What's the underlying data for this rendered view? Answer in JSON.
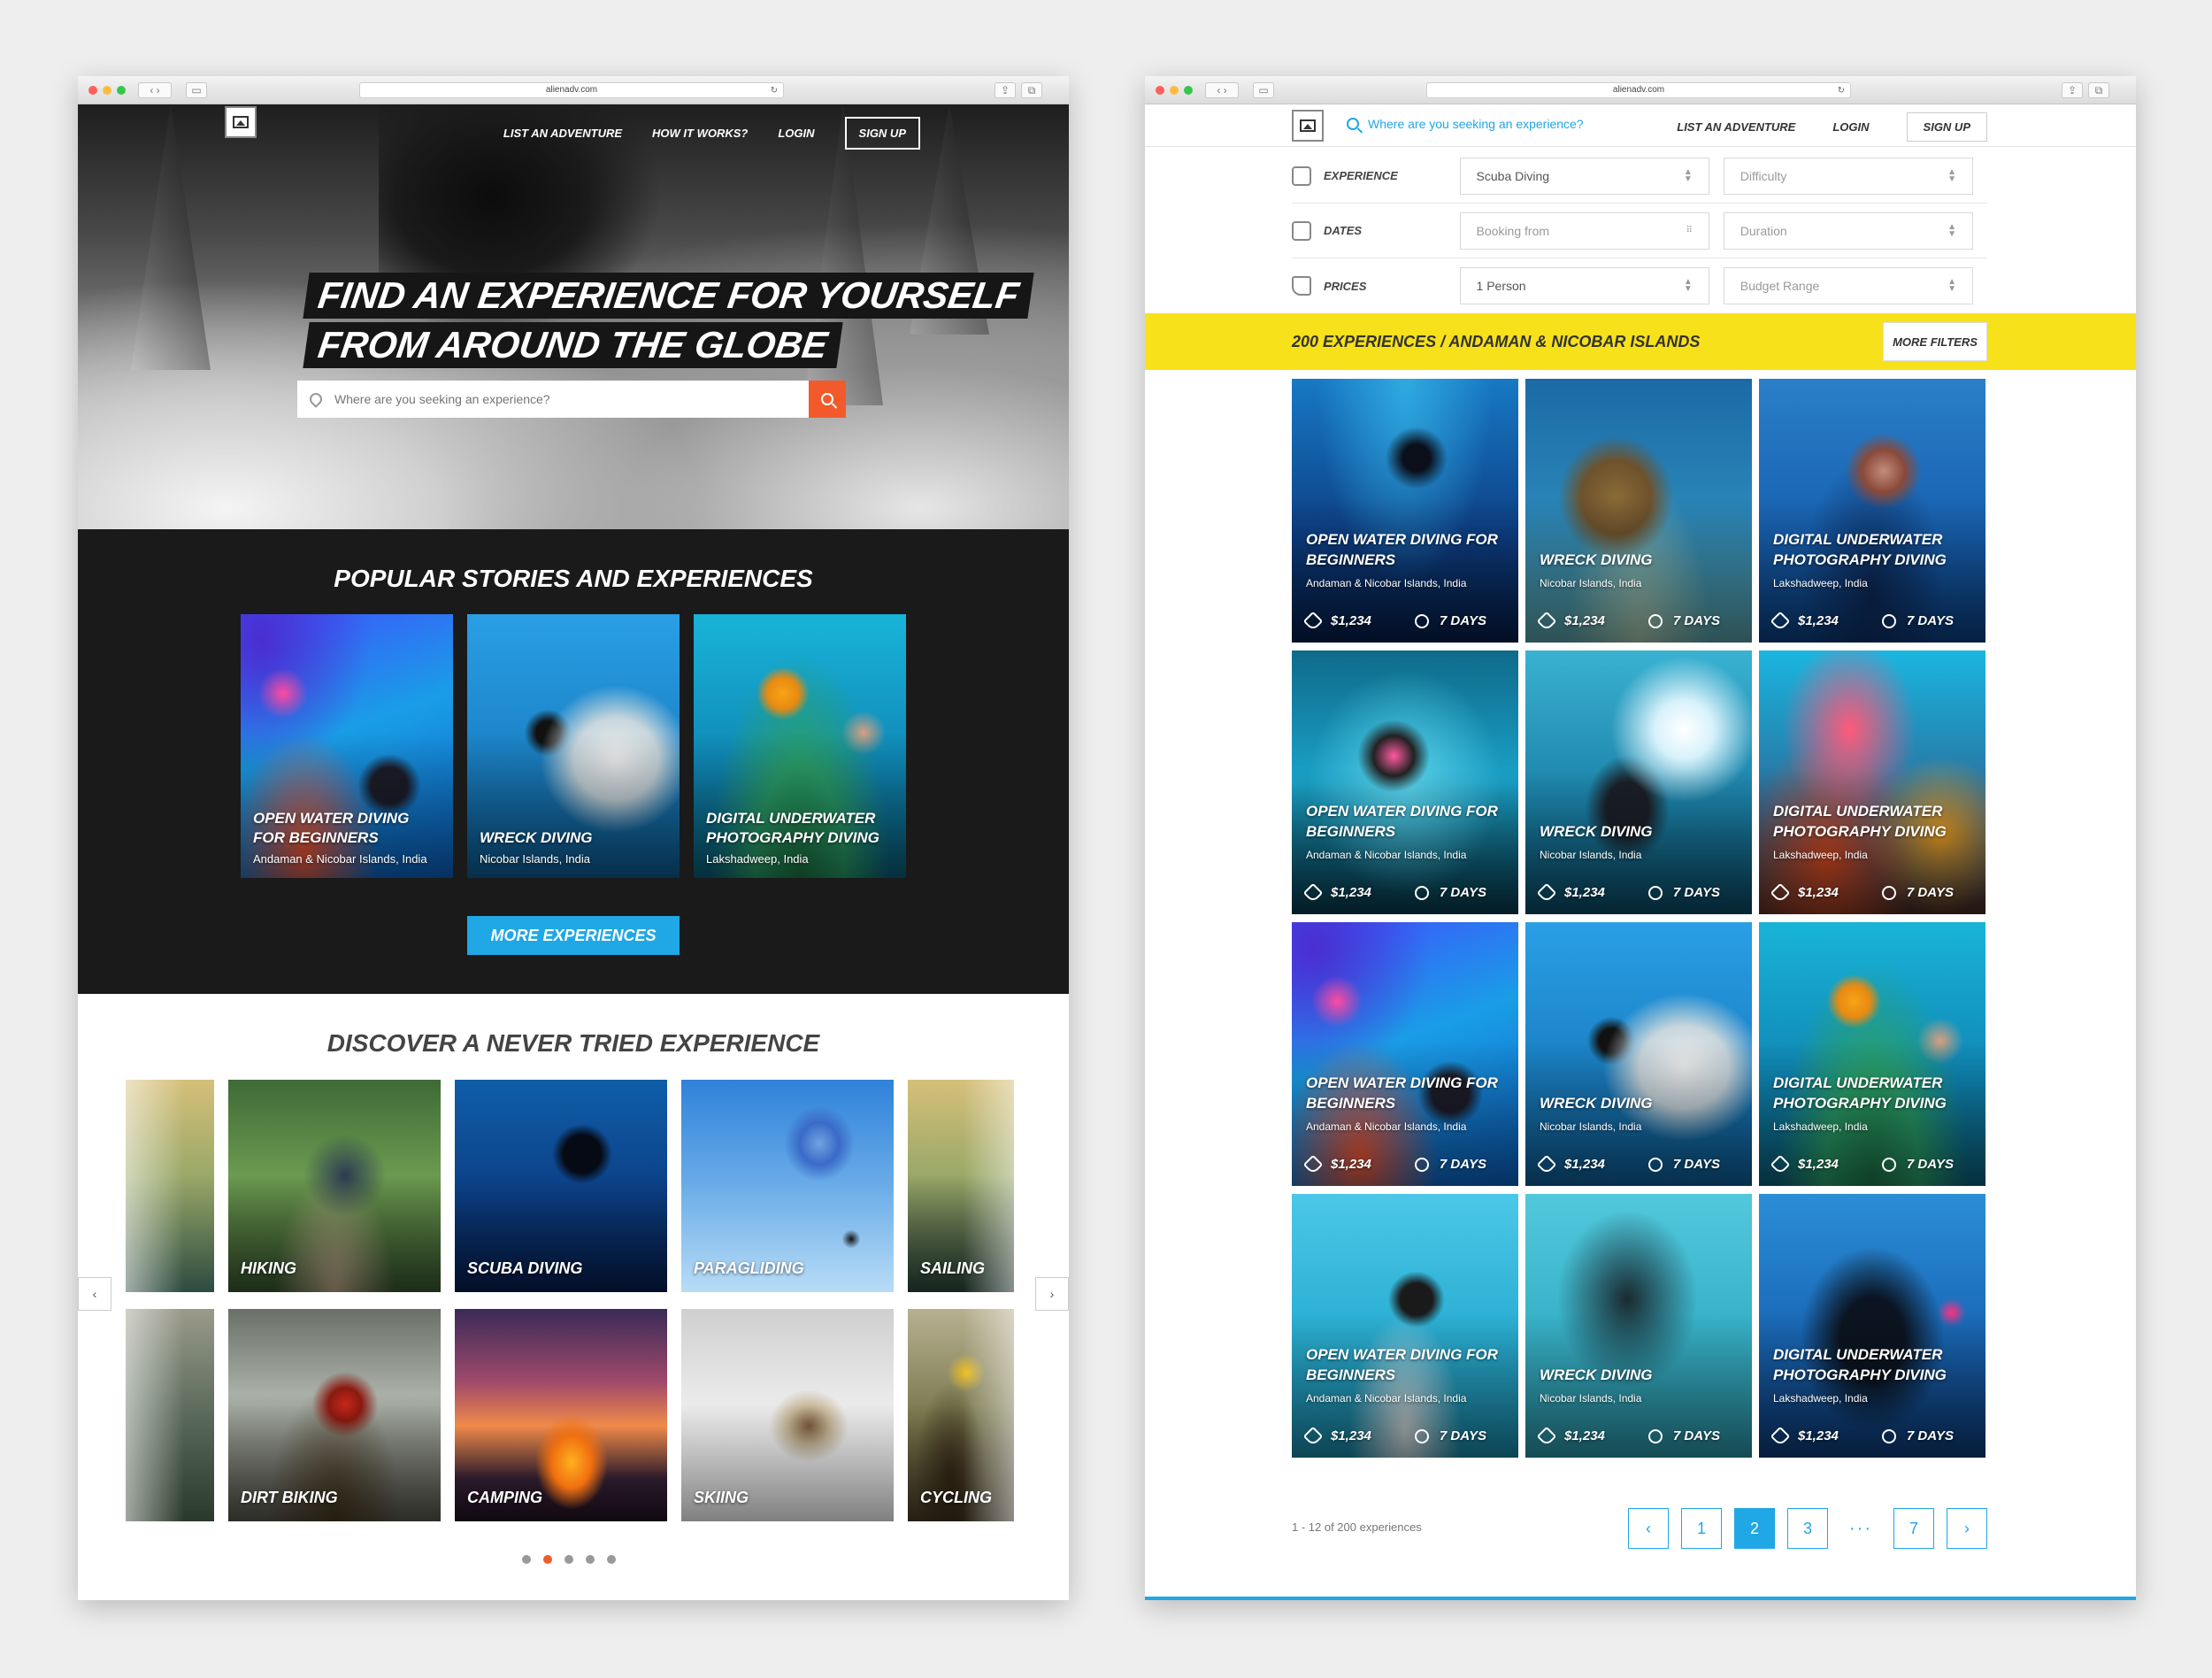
{
  "left": {
    "url": "alienadv.com",
    "nav": {
      "list": "LIST AN ADVENTURE",
      "how": "HOW IT WORKS?",
      "login": "LOGIN",
      "signup": "SIGN UP"
    },
    "hero": {
      "line1": "FIND AN EXPERIENCE FOR YOURSELF",
      "line2": "FROM AROUND THE GLOBE",
      "search_placeholder": "Where are you seeking an experience?"
    },
    "popular": {
      "title": "POPULAR STORIES AND EXPERIENCES",
      "cards": [
        {
          "title": "OPEN WATER DIVING FOR BEGINNERS",
          "location": "Andaman & Nicobar Islands, India"
        },
        {
          "title": "WRECK DIVING",
          "location": "Nicobar Islands, India"
        },
        {
          "title": "DIGITAL UNDERWATER PHOTOGRAPHY DIVING",
          "location": "Lakshadweep, India"
        }
      ],
      "more": "MORE EXPERIENCES"
    },
    "discover": {
      "title": "DISCOVER A NEVER TRIED EXPERIENCE",
      "row1": [
        "",
        "HIKING",
        "SCUBA DIVING",
        "PARAGLIDING",
        "SAILING"
      ],
      "row2": [
        "",
        "DIRT BIKING",
        "CAMPING",
        "SKIING",
        "CYCLING"
      ],
      "prev": "‹",
      "next": "›",
      "active_dot": 2
    }
  },
  "right": {
    "url": "alienadv.com",
    "search_placeholder": "Where are you seeking an experience?",
    "nav": {
      "list": "LIST AN ADVENTURE",
      "login": "LOGIN",
      "signup": "SIGN UP"
    },
    "filters": [
      {
        "label": "EXPERIENCE",
        "a": "Scuba Diving",
        "b": "Difficulty"
      },
      {
        "label": "DATES",
        "a": "Booking from",
        "b": "Duration"
      },
      {
        "label": "PRICES",
        "a": "1 Person",
        "b": "Budget Range"
      }
    ],
    "results": "200 experiences / Andaman & Nicobar Islands",
    "more_filters": "MORE FILTERS",
    "cards": [
      {
        "title": "OPEN WATER DIVING FOR BEGINNERS",
        "location": "Andaman & Nicobar Islands, India",
        "price": "$1,234",
        "days": "7 days"
      },
      {
        "title": "WRECK DIVING",
        "location": "Nicobar Islands, India",
        "price": "$1,234",
        "days": "7 days"
      },
      {
        "title": "DIGITAL UNDERWATER PHOTOGRAPHY DIVING",
        "location": "Lakshadweep, India",
        "price": "$1,234",
        "days": "7 days"
      }
    ],
    "pagination": {
      "info": "1 - 12 of 200 experiences",
      "prev": "‹",
      "p1": "1",
      "p2": "2",
      "p3": "3",
      "ellipsis": "···",
      "p7": "7",
      "next": "›",
      "current": "2"
    }
  }
}
